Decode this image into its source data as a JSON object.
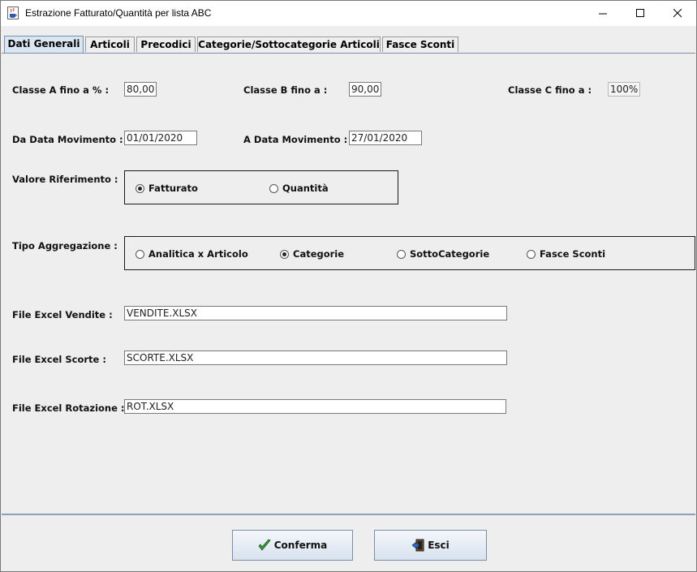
{
  "window": {
    "title": "Estrazione Fatturato/Quantità per lista ABC"
  },
  "tabs": [
    "Dati Generali",
    "Articoli",
    "Precodici",
    "Categorie/Sottocategorie Articoli",
    "Fasce Sconti"
  ],
  "classi": {
    "a_label": "Classe A  fino a % :",
    "a_value": "80,00",
    "b_label": "Classe B  fino a :",
    "b_value": "90,00",
    "c_label": "Classe C  fino a :",
    "c_value": "100%"
  },
  "date": {
    "da_label": "Da Data Movimento :",
    "da_value": "01/01/2020",
    "a_label": "A  Data Movimento :",
    "a_value": "27/01/2020"
  },
  "valore": {
    "label": "Valore Riferimento :",
    "options": [
      "Fatturato",
      "Quantità"
    ],
    "selected": "Fatturato"
  },
  "aggregazione": {
    "label": "Tipo Aggregazione :",
    "options": [
      "Analitica x Articolo",
      "Categorie",
      "SottoCategorie",
      "Fasce Sconti"
    ],
    "selected": "Categorie"
  },
  "files": {
    "vendite_label": "File Excel Vendite :",
    "vendite_value": "VENDITE.XLSX",
    "scorte_label": "File Excel Scorte :",
    "scorte_value": "SCORTE.XLSX",
    "rotazione_label": "File Excel Rotazione :",
    "rotazione_value": "ROT.XLSX"
  },
  "buttons": {
    "conferma": "Conferma",
    "esci": "Esci"
  },
  "icons": {
    "app": "java-cup-icon",
    "conferma": "checkmark-icon",
    "esci": "exit-door-icon"
  }
}
